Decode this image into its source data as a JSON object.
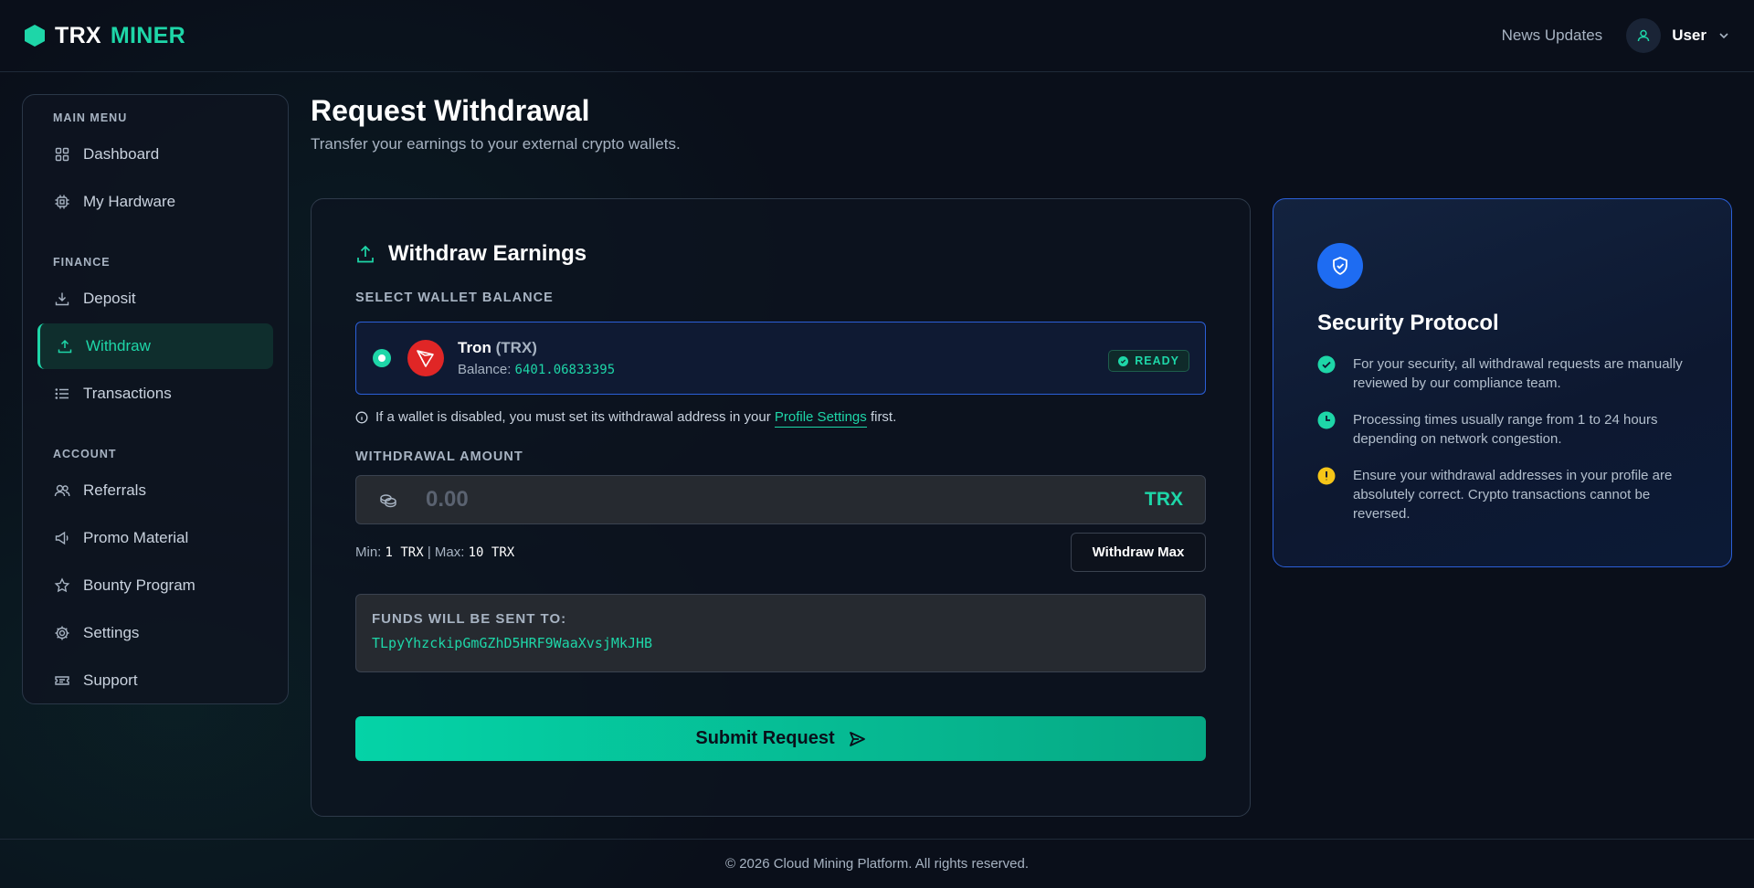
{
  "header": {
    "logo_word1": "TRX",
    "logo_word2": "MINER",
    "news_label": "News Updates",
    "user_label": "User"
  },
  "sidebar": {
    "sections": [
      {
        "label": "MAIN MENU",
        "items": [
          {
            "label": "Dashboard",
            "icon": "grid-icon"
          },
          {
            "label": "My Hardware",
            "icon": "cpu-icon"
          }
        ]
      },
      {
        "label": "FINANCE",
        "items": [
          {
            "label": "Deposit",
            "icon": "download-icon"
          },
          {
            "label": "Withdraw",
            "icon": "upload-icon",
            "active": true
          },
          {
            "label": "Transactions",
            "icon": "list-icon"
          }
        ]
      },
      {
        "label": "ACCOUNT",
        "items": [
          {
            "label": "Referrals",
            "icon": "users-icon"
          },
          {
            "label": "Promo Material",
            "icon": "megaphone-icon"
          },
          {
            "label": "Bounty Program",
            "icon": "star-icon"
          },
          {
            "label": "Settings",
            "icon": "gear-icon"
          },
          {
            "label": "Support",
            "icon": "ticket-icon"
          }
        ]
      }
    ]
  },
  "page": {
    "title": "Request Withdrawal",
    "subtitle": "Transfer your earnings to your external crypto wallets."
  },
  "withdraw_card": {
    "title": "Withdraw Earnings",
    "wallet_label": "SELECT WALLET BALANCE",
    "wallet": {
      "name": "Tron",
      "ticker": "(TRX)",
      "balance_label": "Balance:",
      "balance_value": "6401.06833395",
      "status": "READY"
    },
    "info_text_1": "If a wallet is disabled, you must set its withdrawal address in your",
    "info_link": "Profile Settings",
    "info_text_2": "first.",
    "amount_label": "WITHDRAWAL AMOUNT",
    "amount_placeholder": "0.00",
    "amount_unit": "TRX",
    "min_label": "Min:",
    "min_value": "1 TRX",
    "separator": "|",
    "max_label": "Max:",
    "max_value": "10 TRX",
    "max_button": "Withdraw Max",
    "dest_label": "FUNDS WILL BE SENT TO:",
    "dest_address": "TLpyYhzckipGmGZhD5HRF9WaaXvsjMkJHB",
    "submit_label": "Submit Request"
  },
  "security": {
    "title": "Security Protocol",
    "items": [
      {
        "text": "For your security, all withdrawal requests are manually reviewed by our compliance team.",
        "icon": "check-circle-icon",
        "color": "#1ed6a8"
      },
      {
        "text": "Processing times usually range from 1 to 24 hours depending on network congestion.",
        "icon": "clock-icon",
        "color": "#1ed6a8"
      },
      {
        "text": "Ensure your withdrawal addresses in your profile are absolutely correct. Crypto transactions cannot be reversed.",
        "icon": "alert-circle-icon",
        "color": "#f5c518"
      }
    ]
  },
  "footer": {
    "text": "© 2026 Cloud Mining Platform. All rights reserved."
  },
  "colors": {
    "accent": "#1ed6a8",
    "blue": "#1e6cf2",
    "tron_red": "#e02626",
    "warning": "#f5c518"
  }
}
